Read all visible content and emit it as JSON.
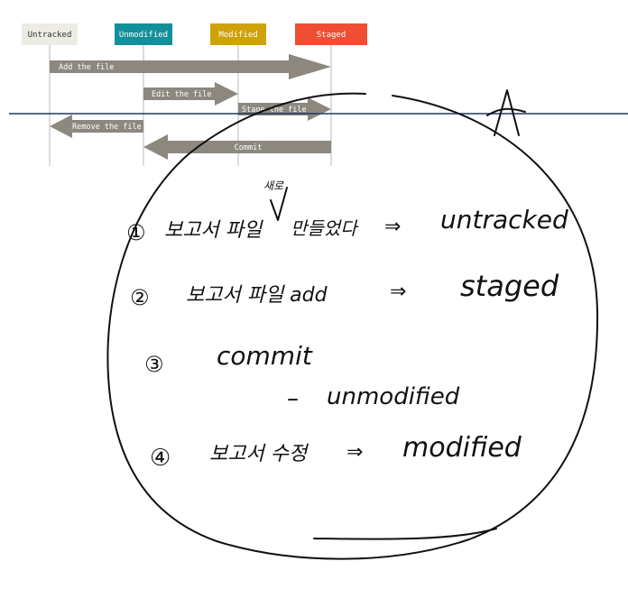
{
  "diagram": {
    "states": [
      {
        "label": "Untracked",
        "bg": "#ecece4",
        "fg": "#333333"
      },
      {
        "label": "Unmodified",
        "bg": "#138f9b",
        "fg": "#ffffff"
      },
      {
        "label": "Modified",
        "bg": "#d0a20a",
        "fg": "#ffffff"
      },
      {
        "label": "Staged",
        "bg": "#f04e31",
        "fg": "#ffffff"
      }
    ],
    "arrows": [
      {
        "label": "Add the file"
      },
      {
        "label": "Edit the file"
      },
      {
        "label": "Stage the file"
      },
      {
        "label": "Remove the file"
      },
      {
        "label": "Commit"
      }
    ],
    "arrow_color": "#8c887f",
    "lifeline_color": "#b8b8b8"
  },
  "annotations": {
    "line_color": "#1f3a60",
    "mark": "A",
    "notes": [
      {
        "num": "①",
        "text": "보고서 파일",
        "insert": "새로",
        "text2": "만들었다",
        "arrow": "⇒",
        "result": "untracked"
      },
      {
        "num": "②",
        "text": "보고서 파일 add",
        "arrow": "⇒",
        "result": "staged"
      },
      {
        "num": "③",
        "text": "commit",
        "dash": "–",
        "result": "unmodified"
      },
      {
        "num": "④",
        "text": "보고서 수정",
        "arrow": "⇒",
        "result": "modified"
      }
    ]
  }
}
